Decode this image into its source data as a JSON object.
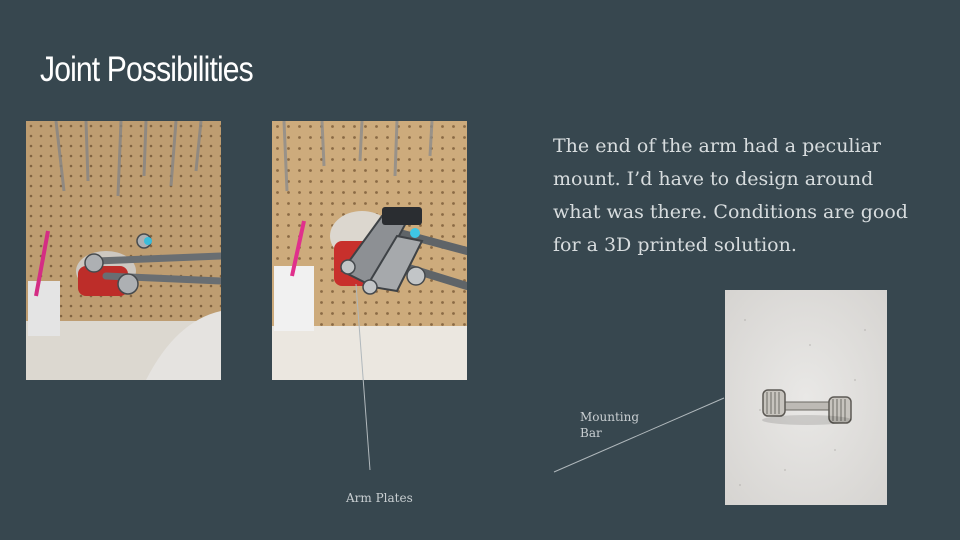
{
  "slide": {
    "title": "Joint Possibilities",
    "body": "The end of the arm had a peculiar mount. I’d have to design around what was there. Conditions are good for a 3D printed solution.",
    "captions": {
      "arm_plates": "Arm Plates",
      "mounting_bar": "Mounting Bar"
    }
  },
  "colors": {
    "background": "#37474f",
    "title": "#ffffff",
    "body_text": "#d7dcde",
    "pegboard": "#c9a97a",
    "callout_line": "#b0b8bc"
  },
  "images": {
    "photo_1": "arm-joint-pegboard-photo",
    "photo_2": "arm-joint-closeup-photo",
    "photo_3": "mounting-bar-photo"
  }
}
